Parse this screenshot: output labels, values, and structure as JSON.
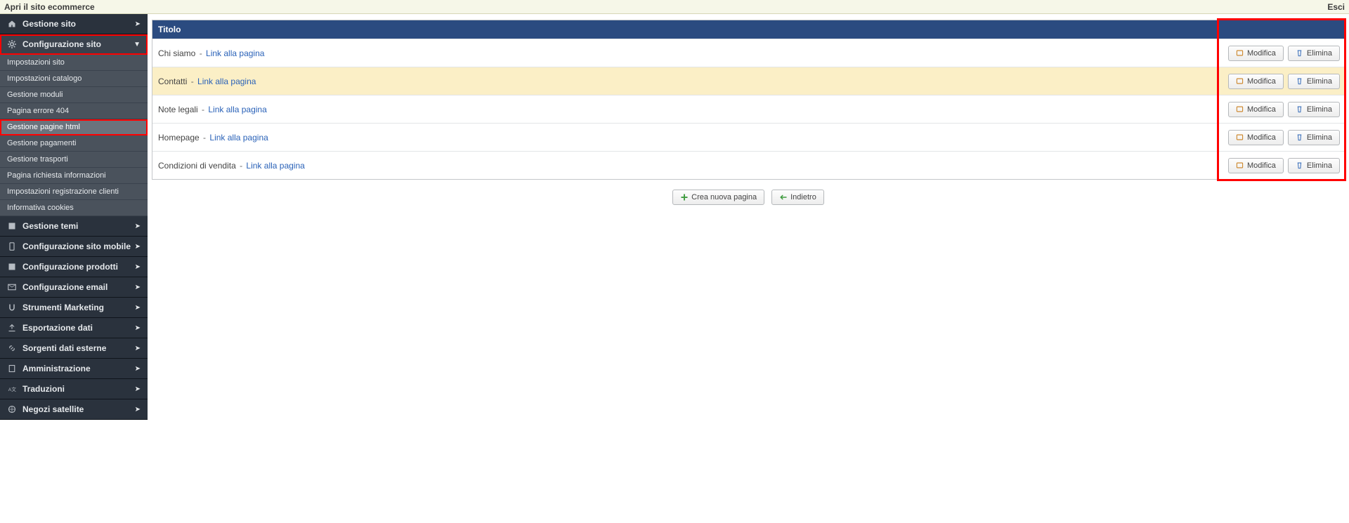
{
  "topbar": {
    "open_site": "Apri il sito ecommerce",
    "logout": "Esci"
  },
  "sidebar": {
    "items": [
      {
        "icon": "home-icon",
        "label": "Gestione sito",
        "expandable": true,
        "expanded": false
      },
      {
        "icon": "gear-icon",
        "label": "Configurazione sito",
        "expandable": true,
        "expanded": true,
        "highlight": true,
        "children": [
          {
            "label": "Impostazioni sito"
          },
          {
            "label": "Impostazioni catalogo"
          },
          {
            "label": "Gestione moduli"
          },
          {
            "label": "Pagina errore 404"
          },
          {
            "label": "Gestione pagine html",
            "selected": true,
            "highlight": true
          },
          {
            "label": "Gestione pagamenti"
          },
          {
            "label": "Gestione trasporti"
          },
          {
            "label": "Pagina richiesta informazioni"
          },
          {
            "label": "Impostazioni registrazione clienti"
          },
          {
            "label": "Informativa cookies"
          }
        ]
      },
      {
        "icon": "puzzle-icon",
        "label": "Gestione temi",
        "expandable": true
      },
      {
        "icon": "mobile-icon",
        "label": "Configurazione sito mobile",
        "expandable": true
      },
      {
        "icon": "puzzle-icon",
        "label": "Configurazione prodotti",
        "expandable": true
      },
      {
        "icon": "mail-icon",
        "label": "Configurazione email",
        "expandable": true
      },
      {
        "icon": "magnet-icon",
        "label": "Strumenti Marketing",
        "expandable": true
      },
      {
        "icon": "export-icon",
        "label": "Esportazione dati",
        "expandable": true
      },
      {
        "icon": "link-icon",
        "label": "Sorgenti dati esterne",
        "expandable": true
      },
      {
        "icon": "building-icon",
        "label": "Amministrazione",
        "expandable": true
      },
      {
        "icon": "translate-icon",
        "label": "Traduzioni",
        "expandable": true
      },
      {
        "icon": "globe-icon",
        "label": "Negozi satellite",
        "expandable": true
      }
    ]
  },
  "table": {
    "header_title": "Titolo",
    "link_text": "Link alla pagina",
    "separator": " - ",
    "modify_label": "Modifica",
    "delete_label": "Elimina",
    "rows": [
      {
        "title": "Chi siamo"
      },
      {
        "title": "Contatti",
        "alt": true
      },
      {
        "title": "Note legali"
      },
      {
        "title": "Homepage"
      },
      {
        "title": "Condizioni di vendita"
      }
    ]
  },
  "footer": {
    "create_label": "Crea nuova pagina",
    "back_label": "Indietro"
  }
}
